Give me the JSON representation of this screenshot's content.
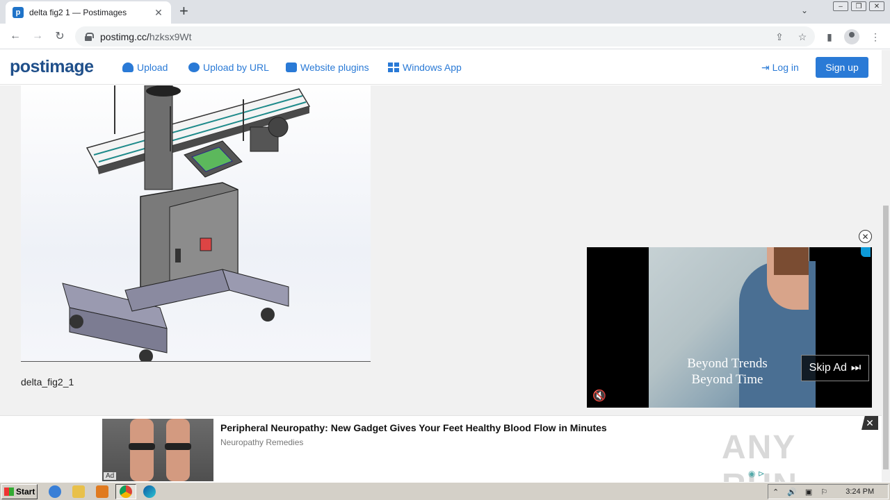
{
  "browser": {
    "tab_title": "delta fig2 1 — Postimages",
    "url_host": "postimg.cc/",
    "url_path": "hzksx9Wt"
  },
  "site": {
    "logo": "postimage",
    "nav": [
      {
        "label": "Upload",
        "icon": "cloud-upload-icon"
      },
      {
        "label": "Upload by URL",
        "icon": "globe-icon"
      },
      {
        "label": "Website plugins",
        "icon": "puzzle-icon"
      },
      {
        "label": "Windows App",
        "icon": "windows-icon"
      }
    ],
    "login": "Log in",
    "signup": "Sign up"
  },
  "image": {
    "caption": "delta_fig2_1"
  },
  "video_ad": {
    "line1": "Beyond Trends",
    "line2": "Beyond Time",
    "skip": "Skip Ad"
  },
  "bottom_ad": {
    "headline": "Peripheral Neuropathy: New Gadget Gives Your Feet Healthy Blood Flow in Minutes",
    "source": "Neuropathy Remedies",
    "tag": "Ad",
    "watermark": "ANY RUN"
  },
  "taskbar": {
    "start": "Start",
    "clock": "3:24 PM"
  },
  "colors": {
    "accent": "#2a7ad6",
    "logo": "#1f4f8a"
  }
}
